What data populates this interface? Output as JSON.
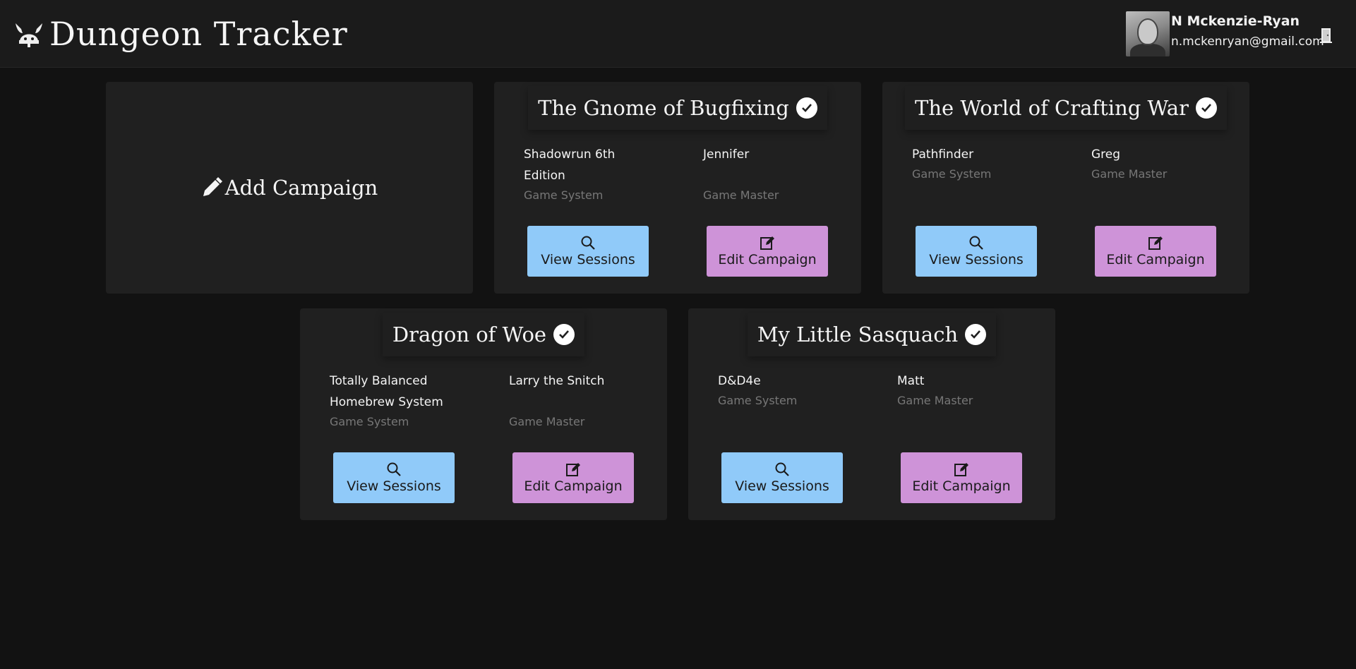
{
  "app": {
    "title": "Dungeon Tracker"
  },
  "user": {
    "name": "N Mckenzie-Ryan",
    "email": "n.mckenryan@gmail.com"
  },
  "add_campaign": {
    "label": "Add Campaign"
  },
  "labels": {
    "game_system": "Game System",
    "game_master": "Game Master",
    "view_sessions": "View Sessions",
    "edit_campaign": "Edit Campaign"
  },
  "colors": {
    "view_button": "#90caf9",
    "edit_button": "#ce93d8",
    "card_background": "#202020",
    "page_background": "#121212"
  },
  "icons": {
    "logo": "viking-helmet-icon",
    "add": "pencil-icon",
    "title_status": "check-circle-icon",
    "view": "magnifier-icon",
    "edit": "edit-square-icon",
    "logout": "door-icon"
  },
  "campaigns": [
    {
      "title": "The Gnome of Bugfixing",
      "game_system": "Shadowrun 6th Edition",
      "game_master": "Jennifer"
    },
    {
      "title": "The World of Crafting War",
      "game_system": "Pathfinder",
      "game_master": "Greg"
    },
    {
      "title": "Dragon of Woe",
      "game_system": "Totally Balanced Homebrew System",
      "game_master": "Larry the Snitch"
    },
    {
      "title": "My Little Sasquach",
      "game_system": "D&D4e",
      "game_master": "Matt"
    }
  ]
}
